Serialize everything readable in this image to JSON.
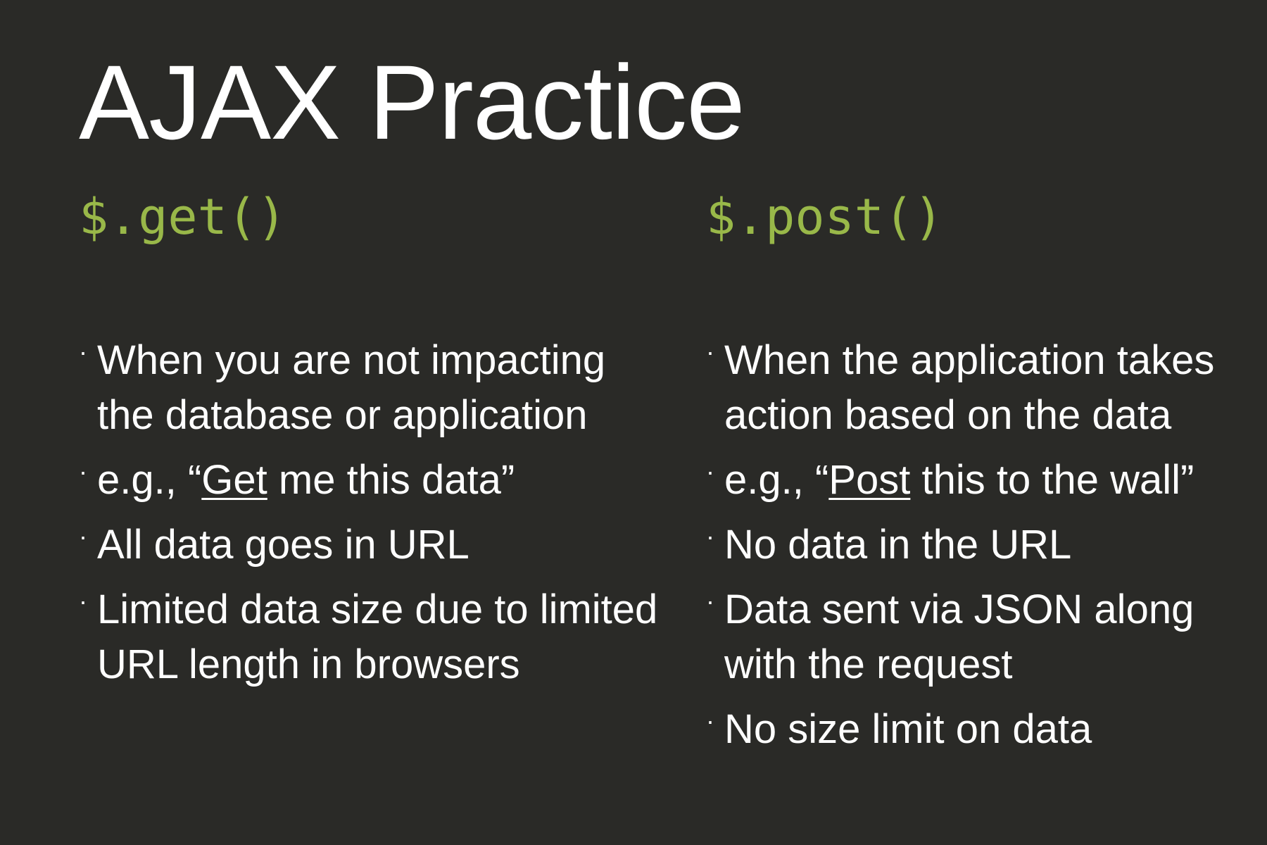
{
  "slide": {
    "title": "AJAX Practice",
    "bullet_glyph": "·",
    "left": {
      "heading": "$.get()",
      "bullets": [
        {
          "text": "When you are not impacting the database or application"
        },
        {
          "pre": "e.g., “",
          "underlined": "Get",
          "post": " me this data”"
        },
        {
          "text": "All data goes in URL"
        },
        {
          "text": "Limited data size due to limited URL length in browsers"
        }
      ]
    },
    "right": {
      "heading": "$.post()",
      "bullets": [
        {
          "text": "When the application takes action based on the data"
        },
        {
          "pre": "e.g., “",
          "underlined": "Post",
          "post": " this to the wall”"
        },
        {
          "text": "No data in the URL"
        },
        {
          "text": "Data sent via JSON along with the request"
        },
        {
          "text": "No size limit on data"
        }
      ]
    },
    "colors": {
      "background": "#2a2a27",
      "text": "#ffffff",
      "code_heading": "#99b849"
    }
  }
}
